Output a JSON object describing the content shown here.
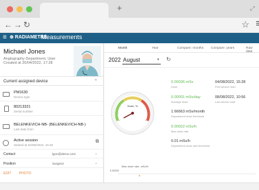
{
  "browser": {
    "tab_title": "",
    "new_tab_symbol": "+",
    "back_icon": "back-arrow-icon",
    "forward_icon": "forward-arrow-icon",
    "reload_icon": "reload-icon",
    "bookmark_icon": "star-icon",
    "menu_icon": "menu-icon"
  },
  "app": {
    "brand": "⊕ RADIAMETRE",
    "title": "Measurements",
    "header_color": "#1d5f86"
  },
  "user": {
    "name": "Michael Jones",
    "role": "Angiography Department, User",
    "created": "Created at 20/04/2022, 17:28"
  },
  "assigned_device": {
    "title": "Current assigned device",
    "devices": [
      {
        "name": "PM1630",
        "type": "Device type"
      },
      {
        "name": "80213321",
        "type": "Serial number"
      },
      {
        "name": "BELENKEVICH-NB- (BELENKEVICH-NB-)",
        "type": "Last data from"
      }
    ]
  },
  "session": {
    "title": "Active session",
    "started": "Started at 04/08/2022, 15:48"
  },
  "contact": {
    "label": "Contact",
    "value": "lgon@demo.com"
  },
  "position": {
    "label": "Position",
    "value": "Surgeon"
  },
  "actions": {
    "edit": "EDIT",
    "photo": "PHOTO"
  },
  "tabs": [
    "Month",
    "Year",
    "Compare: months",
    "Compare: years",
    "Raw data"
  ],
  "active_tab": "Month",
  "filters": {
    "year": "2022",
    "month": "August"
  },
  "gauge": {
    "label": "Dose, %",
    "value_percent": 22
  },
  "stats": [
    {
      "value": "0.00036 mSv",
      "label": "Dose",
      "color": "green",
      "time": "04/08/2022, 15:28",
      "time_label": "First device read"
    },
    {
      "value": "0.00001 mSv/day",
      "label": "Average dose",
      "color": "green",
      "time": "08/08/2022, 10:56",
      "time_label": "Last device read"
    },
    {
      "value": "1.66663 mSv/month",
      "label": "Department dose threshold",
      "color": "dark"
    },
    {
      "value": "0.00022 mSv/h",
      "label": "Max dose rate",
      "color": "green"
    },
    {
      "value": "0.01 mSv/h",
      "label": "Department dose rate threshold",
      "color": "dark"
    }
  ],
  "chart": {
    "title": "Max dose rate, mSv/h",
    "y_tick": "0.00025"
  }
}
